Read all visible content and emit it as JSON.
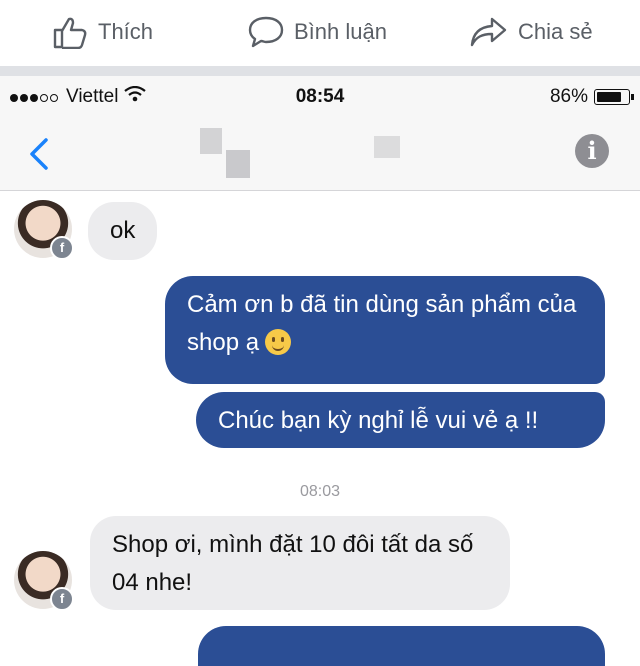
{
  "fb_actions": {
    "like": {
      "label": "Thích",
      "icon": "thumbs-up-icon"
    },
    "comment": {
      "label": "Bình luận",
      "icon": "speech-bubble-icon"
    },
    "share": {
      "label": "Chia sẻ",
      "icon": "share-arrow-icon"
    }
  },
  "status_bar": {
    "carrier": "Viettel",
    "time": "08:54",
    "battery": "86%",
    "battery_level": 0.86
  },
  "nav": {
    "back_icon": "chevron-left-icon",
    "info_label": "i"
  },
  "messages": [
    {
      "direction": "in",
      "text": "ok"
    },
    {
      "direction": "out",
      "text": "Cảm ơn b đã tin dùng sản phẩm của shop ạ",
      "emoji": "smile-emoji"
    },
    {
      "direction": "out",
      "text": "Chúc bạn kỳ nghỉ lễ vui vẻ ạ !!"
    },
    {
      "direction": "in",
      "text": "Shop ơi, mình đặt 10 đôi tất da số 04 nhe!"
    }
  ],
  "timestamp": "08:03",
  "avatar_badge": "f",
  "colors": {
    "outgoing": "#2b4e95",
    "incoming": "#ececee",
    "ios_blue": "#1a82fb"
  }
}
